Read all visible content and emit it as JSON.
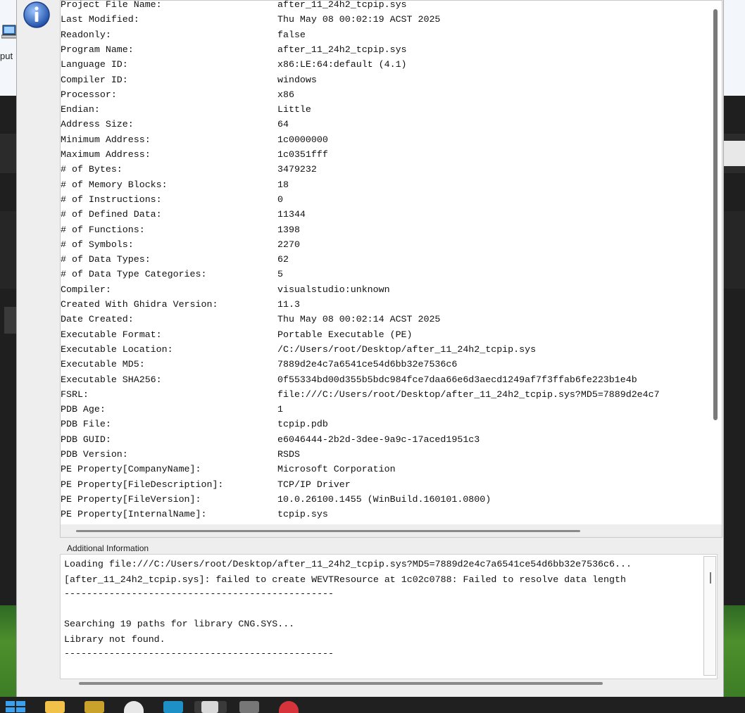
{
  "desktop": {
    "icon_label": "put",
    "edge_text": "\\"
  },
  "properties": [
    {
      "key": "Project File Name:",
      "value": "after_11_24h2_tcpip.sys"
    },
    {
      "key": "Last Modified:",
      "value": "Thu May 08 00:02:19 ACST 2025"
    },
    {
      "key": "Readonly:",
      "value": "false"
    },
    {
      "key": "Program Name:",
      "value": "after_11_24h2_tcpip.sys"
    },
    {
      "key": "Language ID:",
      "value": "x86:LE:64:default (4.1)"
    },
    {
      "key": "Compiler ID:",
      "value": "windows"
    },
    {
      "key": "Processor:",
      "value": "x86"
    },
    {
      "key": "Endian:",
      "value": "Little"
    },
    {
      "key": "Address Size:",
      "value": "64"
    },
    {
      "key": "Minimum Address:",
      "value": "1c0000000"
    },
    {
      "key": "Maximum Address:",
      "value": "1c0351fff"
    },
    {
      "key": "# of Bytes:",
      "value": "3479232"
    },
    {
      "key": "# of Memory Blocks:",
      "value": "18"
    },
    {
      "key": "# of Instructions:",
      "value": "0"
    },
    {
      "key": "# of Defined Data:",
      "value": "11344"
    },
    {
      "key": "# of Functions:",
      "value": "1398"
    },
    {
      "key": "# of Symbols:",
      "value": "2270"
    },
    {
      "key": "# of Data Types:",
      "value": "62"
    },
    {
      "key": "# of Data Type Categories:",
      "value": "5"
    },
    {
      "key": "Compiler:",
      "value": "visualstudio:unknown"
    },
    {
      "key": "Created With Ghidra Version:",
      "value": "11.3"
    },
    {
      "key": "Date Created:",
      "value": "Thu May 08 00:02:14 ACST 2025"
    },
    {
      "key": "Executable Format:",
      "value": "Portable Executable (PE)"
    },
    {
      "key": "Executable Location:",
      "value": "/C:/Users/root/Desktop/after_11_24h2_tcpip.sys"
    },
    {
      "key": "Executable MD5:",
      "value": "7889d2e4c7a6541ce54d6bb32e7536c6"
    },
    {
      "key": "Executable SHA256:",
      "value": "0f55334bd00d355b5bdc984fce7daa66e6d3aecd1249af7f3ffab6fe223b1e4b"
    },
    {
      "key": "FSRL:",
      "value": "file:///C:/Users/root/Desktop/after_11_24h2_tcpip.sys?MD5=7889d2e4c7"
    },
    {
      "key": "PDB Age:",
      "value": "1"
    },
    {
      "key": "PDB File:",
      "value": "tcpip.pdb"
    },
    {
      "key": "PDB GUID:",
      "value": "e6046444-2b2d-3dee-9a9c-17aced1951c3"
    },
    {
      "key": "PDB Version:",
      "value": "RSDS"
    },
    {
      "key": "PE Property[CompanyName]:",
      "value": "Microsoft Corporation"
    },
    {
      "key": "PE Property[FileDescription]:",
      "value": "TCP/IP Driver"
    },
    {
      "key": "PE Property[FileVersion]:",
      "value": "10.0.26100.1455 (WinBuild.160101.0800)"
    },
    {
      "key": "PE Property[InternalName]:",
      "value": "tcpip.sys"
    }
  ],
  "additional_info": {
    "title": "Additional Information",
    "lines": [
      "Loading file:///C:/Users/root/Desktop/after_11_24h2_tcpip.sys?MD5=7889d2e4c7a6541ce54d6bb32e7536c6...",
      "[after_11_24h2_tcpip.sys]: failed to create WEVTResource at 1c02c0788: Failed to resolve data length",
      "------------------------------------------------",
      "",
      "Searching 19 paths for library CNG.SYS...",
      "Library not found.",
      "------------------------------------------------"
    ]
  },
  "icons": {
    "info": "info-icon",
    "desktop": "computer-icon"
  },
  "colors": {
    "info_blue": "#2a5fb8",
    "dialog_bg": "#eeeeee",
    "taskbar": "#202020"
  }
}
